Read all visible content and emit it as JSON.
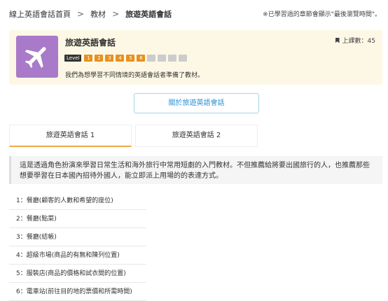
{
  "breadcrumb": {
    "home": "線上英語會話首頁",
    "materials": "教材",
    "current": "旅遊英語會話",
    "separator": ">"
  },
  "note": "※已學習過的章節會顯示\"最後瀏覽時間\"。",
  "course": {
    "icon": "airplane-icon",
    "title": "旅遊英語會話",
    "lessons_label": "上課數：45",
    "level_label": "Level",
    "levels": [
      "1",
      "2",
      "3",
      "4",
      "5",
      "6",
      "",
      "",
      "",
      ""
    ],
    "levels_active_count": 6,
    "description": "我們為想學習不同情境的英語會話者準備了教材。"
  },
  "about_button": "關於旅遊英語會話",
  "tabs": [
    {
      "label": "旅遊英語會話 1",
      "active": true
    },
    {
      "label": "旅遊英語會話 2",
      "active": false
    }
  ],
  "intro": "這是透過角色扮演來學習日常生活和海外旅行中常用短劇的入門教材。不但推薦給將要出國旅行的人，也推薦那些想要學習在日本國內招待外國人，能立即派上用場的的表達方式。",
  "chapters": [
    "1：餐廳(顧客的人數和希望的座位)",
    "2：餐廳(點菜)",
    "3：餐廳(結帳)",
    "4：超級市場(商品的有無和陳列位置)",
    "5：服裝店(商品的價格和試衣間的位置)",
    "6：電車站(前往目的地的票價和所需時間)"
  ],
  "colors": {
    "thumb_bg": "#a97ac9",
    "level_active": "#e8901e",
    "link": "#2a8fd3",
    "tab_active_underline": "#f0a848",
    "card_bg": "#fdf8e6"
  }
}
